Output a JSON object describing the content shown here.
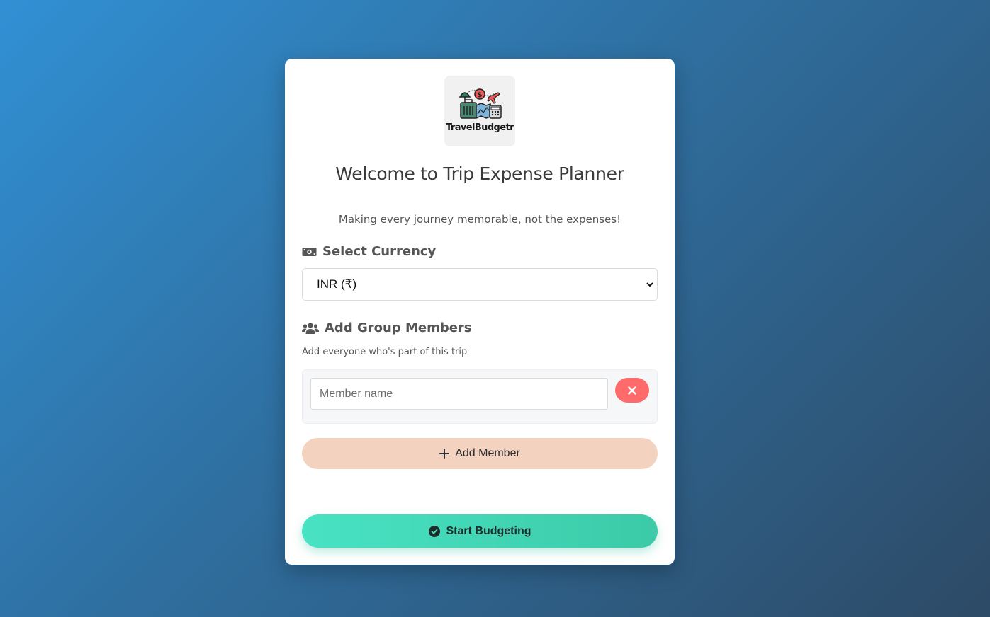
{
  "logo": {
    "brand_text": "TravelBudgetr",
    "icon": "travel-budget-logo-icon"
  },
  "header": {
    "title": "Welcome to Trip Expense Planner",
    "tagline": "Making every journey memorable, not the expenses!"
  },
  "currency": {
    "heading": "Select Currency",
    "icon": "money-bill-icon",
    "selected": "INR (₹)"
  },
  "members": {
    "heading": "Add Group Members",
    "icon": "users-icon",
    "helper": "Add everyone who's part of this trip",
    "rows": [
      {
        "value": "",
        "placeholder": "Member name"
      }
    ],
    "add_label": "Add Member"
  },
  "actions": {
    "start_label": "Start Budgeting"
  },
  "colors": {
    "remove_button": "#ff6b6b",
    "add_button": "#f3d3bf",
    "start_button": "#48e3c3"
  }
}
